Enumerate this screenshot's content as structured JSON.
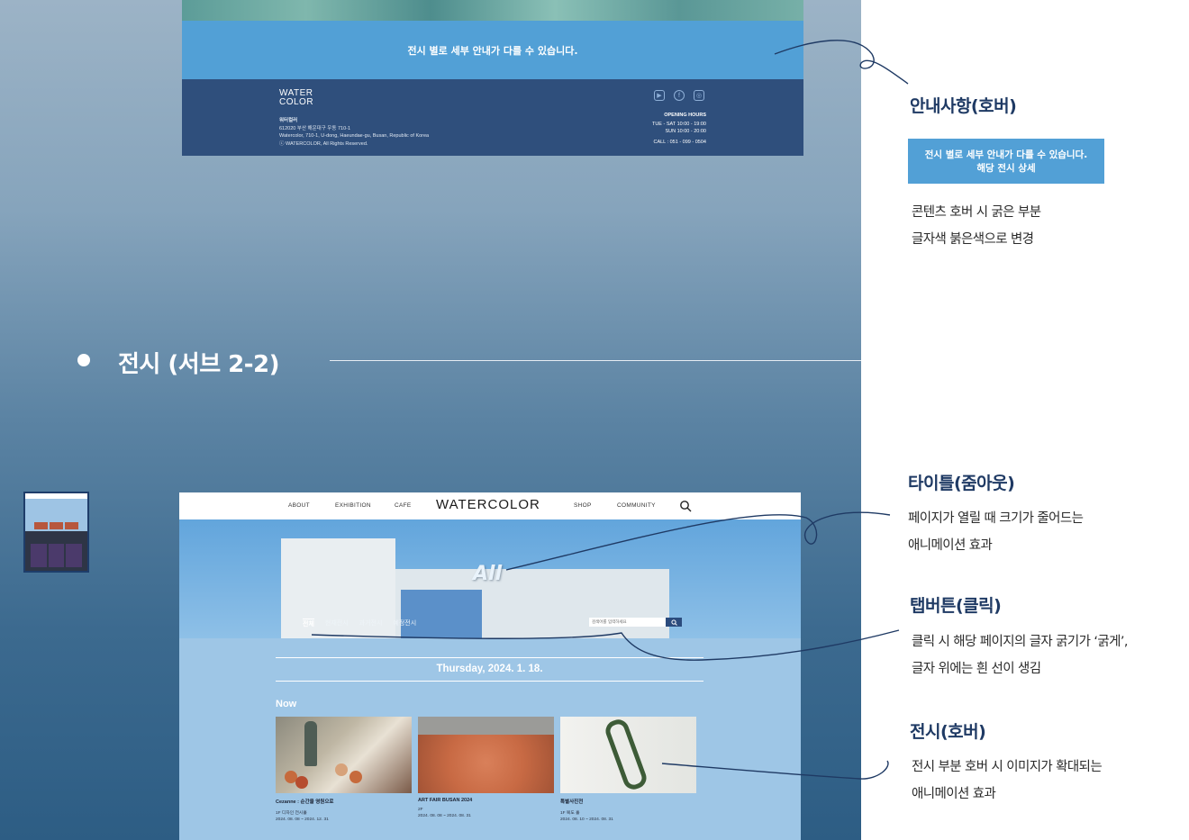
{
  "footer_mockup": {
    "notice": "전시 별로 세부 안내가 다를 수 있습니다.",
    "logo_line1": "WATER",
    "logo_line2": "COLOR",
    "brand_name": "워터컬러",
    "address_kr": "612020 부산 해운대구 우동 710-1",
    "address_en": "Watercolor, 710-1, U-dong, Haeundae-gu, Busan, Republic of Korea",
    "copyright": "ⓒ WATERCOLOR, All Rights Reserved.",
    "icons": [
      "youtube-icon",
      "facebook-icon",
      "instagram-icon"
    ],
    "hours_title": "OPENING HOURS",
    "hours_weekday": "TUE - SAT 10:00 - 19:00",
    "hours_sunday": "SUN 10:00 - 20:00",
    "call": "CALL : 051 - 099 - 0504"
  },
  "annotations": {
    "notice_hover": {
      "title": "안내사항(호버)",
      "demo_line1": "전시 별로 세부 안내가 다를 수 있습니다.",
      "demo_line2": "해당 전시 상세",
      "desc_line1": "콘텐츠 호버 시 굵은 부분",
      "desc_line2": "글자색 붉은색으로 변경"
    },
    "title_zoom": {
      "title": "타이틀(줌아웃)",
      "desc_line1": "페이지가 열릴 때 크기가 줄어드는",
      "desc_line2": "애니메이션 효과"
    },
    "tab_click": {
      "title": "탭버튼(클릭)",
      "desc_line1": "클릭 시 해당 페이지의 글자 굵기가 ‘굵게’,",
      "desc_line2": "글자 위에는 흰 선이 생김"
    },
    "exhibit_hover": {
      "title": "전시(호버)",
      "desc_line1": "전시 부분 호버 시 이미지가 확대되는",
      "desc_line2": "애니메이션 효과"
    }
  },
  "section": {
    "title": "전시 (서브 2-2)"
  },
  "exhibition_page": {
    "nav": {
      "items_left": [
        "ABOUT",
        "EXHIBITION",
        "CAFE"
      ],
      "logo": "WATERCOLOR",
      "items_right": [
        "SHOP",
        "COMMUNITY"
      ]
    },
    "hero_title": "All",
    "tabs": [
      "전체",
      "현재전시",
      "과거전시",
      "예정전시"
    ],
    "search_placeholder": "검색어를 입력하세요",
    "date": "Thursday, 2024. 1. 18.",
    "now_label": "Now",
    "cards": [
      {
        "title": "Cezanne : 순간을 영원으로",
        "location": "1F 디자인 전시홀",
        "dates": "2024. 08. 08 ~ 2024. 12. 31"
      },
      {
        "title": "ART FAIR BUSAN 2024",
        "location": "2F",
        "dates": "2024. 08. 08 ~ 2024. 08. 31"
      },
      {
        "title": "특별사진전",
        "location": "1F 복도 홀",
        "dates": "2024. 08. 10 ~ 2024. 08. 31"
      }
    ]
  },
  "colors": {
    "notice_blue": "#52a0d6",
    "footer_navy": "#2f4f7c",
    "annotation_navy": "#1f3a64"
  }
}
